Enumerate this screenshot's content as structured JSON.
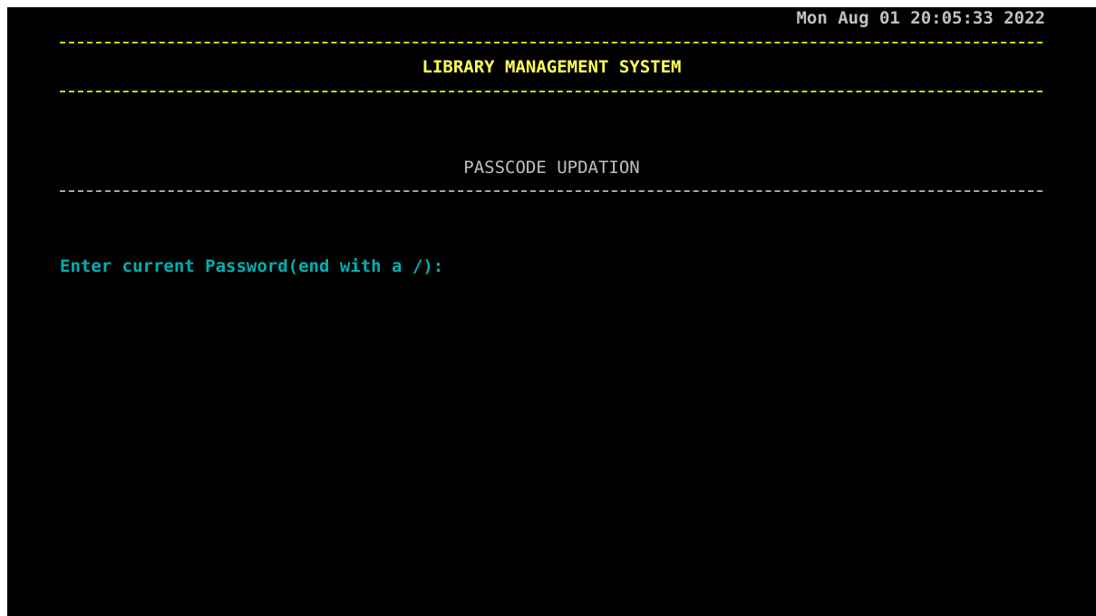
{
  "header": {
    "datetime": "Mon Aug 01 20:05:33 2022",
    "system_title": "LIBRARY MANAGEMENT SYSTEM"
  },
  "section": {
    "title": "PASSCODE UPDATION"
  },
  "form": {
    "current_password_prompt": "Enter current Password(end with a /):",
    "current_password_value": ""
  },
  "colors": {
    "background": "#000000",
    "title": "#ffff55",
    "text": "#c0c0c0",
    "prompt": "#00b0b0"
  }
}
